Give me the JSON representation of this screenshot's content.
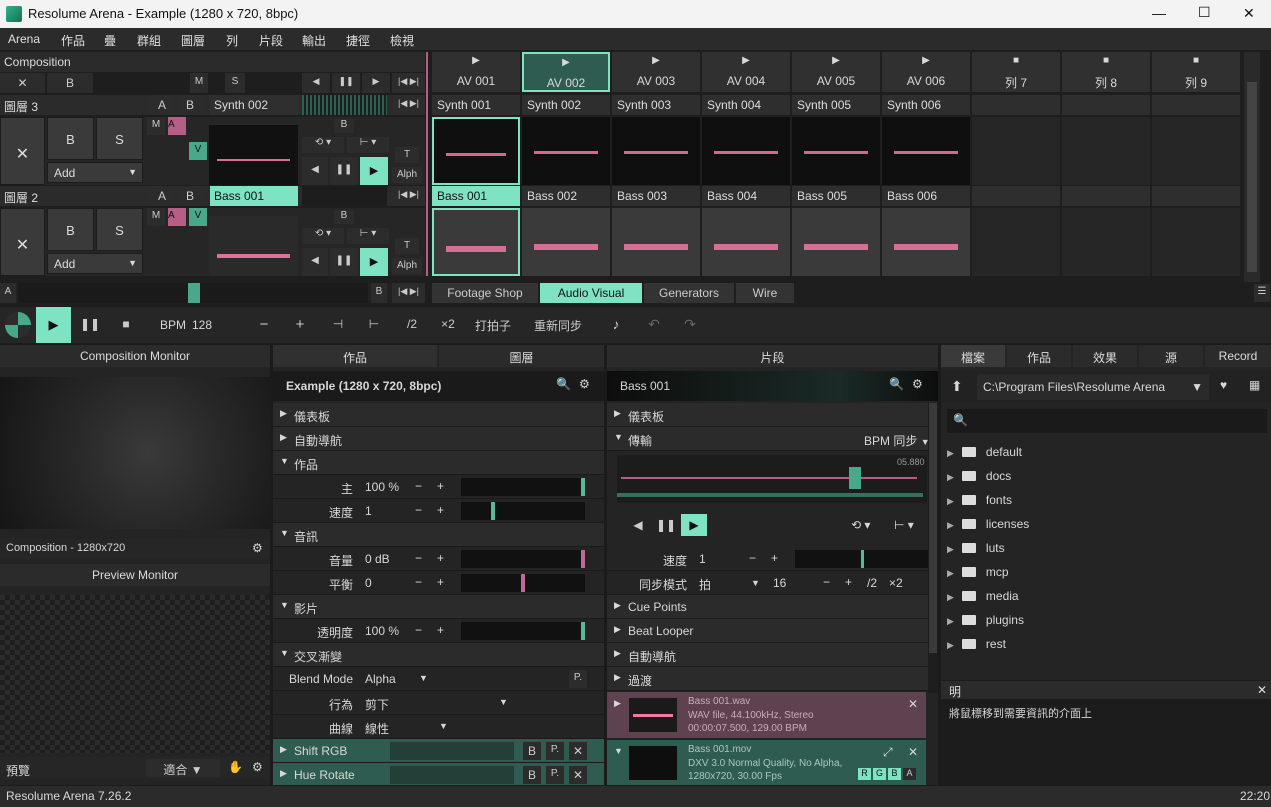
{
  "window": {
    "title": "Resolume Arena - Example (1280 x 720, 8bpc)",
    "min": "—",
    "max": "☐",
    "close": "✕"
  },
  "menu": [
    "Arena",
    "作品",
    "疊",
    "群組",
    "圖層",
    "列",
    "片段",
    "輸出",
    "捷徑",
    "檢視"
  ],
  "composition_label": "Composition",
  "comp_row": {
    "x": "✕",
    "b": "B",
    "m": "M",
    "s": "S"
  },
  "columns": [
    {
      "label": "AV 001",
      "icon": "▶"
    },
    {
      "label": "AV 002",
      "icon": "▶"
    },
    {
      "label": "AV 003",
      "icon": "▶"
    },
    {
      "label": "AV 004",
      "icon": "▶"
    },
    {
      "label": "AV 005",
      "icon": "▶"
    },
    {
      "label": "AV 006",
      "icon": "▶"
    },
    {
      "label": "列 7",
      "icon": "■"
    },
    {
      "label": "列 8",
      "icon": "■"
    },
    {
      "label": "列 9",
      "icon": "■"
    }
  ],
  "layer3": {
    "name": "圖層 3",
    "a": "A",
    "b": "B",
    "clip": "Synth 002",
    "x": "✕",
    "B": "B",
    "S": "S",
    "add": "Add",
    "m": "M",
    "A": "A",
    "V": "V",
    "T": "T",
    "alpha": "Alph",
    "clips": [
      "Synth 001",
      "Synth 002",
      "Synth 003",
      "Synth 004",
      "Synth 005",
      "Synth 006"
    ]
  },
  "layer2": {
    "name": "圖層 2",
    "a": "A",
    "b": "B",
    "clip": "Bass 001",
    "x": "✕",
    "B": "B",
    "S": "S",
    "add": "Add",
    "m": "M",
    "A": "A",
    "V": "V",
    "T": "T",
    "alpha": "Alph",
    "clips": [
      "Bass 001",
      "Bass 002",
      "Bass 003",
      "Bass 004",
      "Bass 005",
      "Bass 006"
    ]
  },
  "crossfader": {
    "a": "A",
    "b": "B"
  },
  "deck_tabs": [
    "Footage Shop",
    "Audio Visual",
    "Generators",
    "Wire"
  ],
  "transport": {
    "bpm_label": "BPM",
    "bpm": "128",
    "minus": "−",
    "plus": "+",
    "half": "/2",
    "double": "×2",
    "tap": "打拍子",
    "resync": "重新同步"
  },
  "monitor": {
    "title": "Composition Monitor",
    "caption": "Composition - 1280x720",
    "preview_title": "Preview Monitor",
    "preview": "預覽",
    "fit": "適合"
  },
  "comp_panel": {
    "tabs": [
      "作品",
      "圖層"
    ],
    "title": "Example (1280 x 720, 8bpc)",
    "sections": {
      "dashboard": "儀表板",
      "autopilot": "自動導航",
      "comp": "作品",
      "audio": "音訊",
      "video": "影片",
      "crossfade": "交叉漸變"
    },
    "master_lbl": "主",
    "master": "100 %",
    "speed_lbl": "速度",
    "speed": "1",
    "volume_lbl": "音量",
    "volume": "0 dB",
    "pan_lbl": "平衡",
    "pan": "0",
    "opacity_lbl": "透明度",
    "opacity": "100 %",
    "blend_lbl": "Blend Mode",
    "blend": "Alpha",
    "behave_lbl": "行為",
    "behave": "剪下",
    "curve_lbl": "曲線",
    "curve": "線性",
    "p": "P.",
    "effects": [
      {
        "name": "Shift RGB"
      },
      {
        "name": "Hue Rotate"
      }
    ],
    "b": "B",
    "x": "✕"
  },
  "clip_panel": {
    "title": "片段",
    "clip": "Bass 001",
    "dashboard": "儀表板",
    "transport": "傳輸",
    "bpm_sync": "BPM 同步",
    "time": "05.880",
    "speed_lbl": "速度",
    "speed": "1",
    "sync_lbl": "同步模式",
    "sync": "拍",
    "beats": "16",
    "half": "/2",
    "double": "×2",
    "cue": "Cue Points",
    "looper": "Beat Looper",
    "autopilot": "自動導航",
    "transition": "過渡",
    "file1": {
      "name": "Bass 001.wav",
      "info": "WAV file, 44.100kHz, Stereo",
      "dur": "00:00:07.500, 129.00 BPM"
    },
    "file2": {
      "name": "Bass 001.mov",
      "info": "DXV 3.0 Normal Quality, No Alpha,",
      "res": "1280x720, 30.00 Fps"
    },
    "rgba": [
      "R",
      "G",
      "B",
      "A"
    ]
  },
  "browser": {
    "tabs": [
      "檔案",
      "作品",
      "效果",
      "源",
      "Record"
    ],
    "path": "C:\\Program Files\\Resolume Arena",
    "folders": [
      "default",
      "docs",
      "fonts",
      "licenses",
      "luts",
      "mcp",
      "media",
      "plugins",
      "rest"
    ],
    "help_title": "明",
    "help_text": "將鼠標移到需要資訊的介面上"
  },
  "status": {
    "version": "Resolume Arena 7.26.2",
    "time": "22:20"
  },
  "colors": {
    "mint": "#7de3c2",
    "pink": "#f07aa6",
    "bg": "#1b1b1b"
  }
}
